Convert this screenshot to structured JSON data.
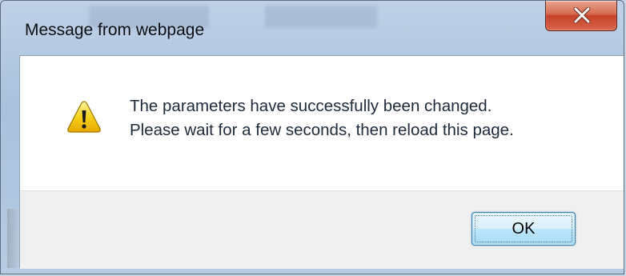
{
  "window": {
    "title": "Message from webpage"
  },
  "controls": {
    "close_icon": "close-icon"
  },
  "message": {
    "icon": "warning-icon",
    "line1": "The parameters have successfully been changed.",
    "line2": "Please wait for a few seconds, then reload this page."
  },
  "buttons": {
    "ok_label": "OK"
  },
  "colors": {
    "close_button": "#c6412a",
    "ok_button_border": "#3c7fb1",
    "footer_background": "#f0f0f0",
    "title_bar_glass": "#a9c1dd",
    "warning_yellow": "#f7d11b"
  }
}
